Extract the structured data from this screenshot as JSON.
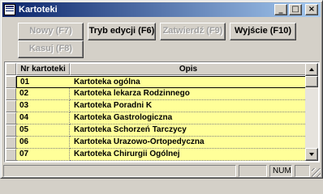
{
  "window": {
    "title": "Kartoteki",
    "controls": {
      "minimize": "_",
      "maximize": "□",
      "close": "×"
    }
  },
  "toolbar": {
    "new_label": "Nowy (F7)",
    "edit_mode_label": "Tryb edycji (F6)",
    "confirm_label": "Zatwierdź (F9)",
    "exit_label": "Wyjście (F10)",
    "delete_label": "Kasuj (F8)"
  },
  "table": {
    "columns": [
      "Nr kartoteki",
      "Opis"
    ],
    "rows": [
      {
        "nr": "01",
        "opis": "Kartoteka ogólna"
      },
      {
        "nr": "02",
        "opis": "Kartoteka lekarza Rodzinnego"
      },
      {
        "nr": "03",
        "opis": "Kartoteka Poradni K"
      },
      {
        "nr": "04",
        "opis": "Kartoteka Gastrologiczna"
      },
      {
        "nr": "05",
        "opis": "Kartoteka Schorzeń Tarczycy"
      },
      {
        "nr": "06",
        "opis": "Kartoteka Urazowo-Ortopedyczna"
      },
      {
        "nr": "07",
        "opis": "Kartoteka Chirurgii Ogólnej"
      }
    ],
    "row_color": "#ffff99"
  },
  "statusbar": {
    "num_indicator": "NUM"
  }
}
